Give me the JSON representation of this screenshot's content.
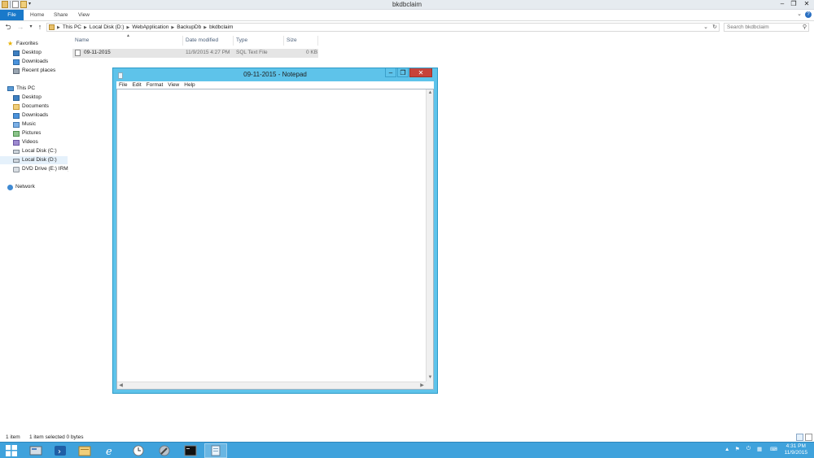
{
  "explorer": {
    "title": "bkdbclaim",
    "ribbon_tabs": [
      "File",
      "Home",
      "Share",
      "View"
    ],
    "breadcrumbs": [
      "This PC",
      "Local Disk (D:)",
      "WebApplication",
      "BackupDb",
      "bkdbclaim"
    ],
    "search_placeholder": "Search bkdbclaim",
    "columns": [
      "Name",
      "Date modified",
      "Type",
      "Size"
    ],
    "files": [
      {
        "name": "09-11-2015",
        "date": "11/9/2015 4:27 PM",
        "type": "SQL Text File",
        "size": "0 KB"
      }
    ],
    "nav": {
      "favorites": {
        "label": "Favorites",
        "items": [
          "Desktop",
          "Downloads",
          "Recent places"
        ]
      },
      "this_pc": {
        "label": "This PC",
        "items": [
          "Desktop",
          "Documents",
          "Downloads",
          "Music",
          "Pictures",
          "Videos",
          "Local Disk (C:)",
          "Local Disk (D:)",
          "DVD Drive (E:) IRM_S"
        ]
      },
      "network": {
        "label": "Network"
      }
    },
    "status": {
      "count": "1 item",
      "selection": "1 item selected  0 bytes"
    }
  },
  "notepad": {
    "title": "09-11-2015 - Notepad",
    "menu": [
      "File",
      "Edit",
      "Format",
      "View",
      "Help"
    ],
    "content": ""
  },
  "taskbar": {
    "clock_time": "4:31 PM",
    "clock_date": "11/9/2015",
    "accent": "#3fa2dc"
  },
  "colors": {
    "file_tab": "#1979ca",
    "notepad_frame": "#5ec3ea",
    "close_button": "#c7433a"
  }
}
